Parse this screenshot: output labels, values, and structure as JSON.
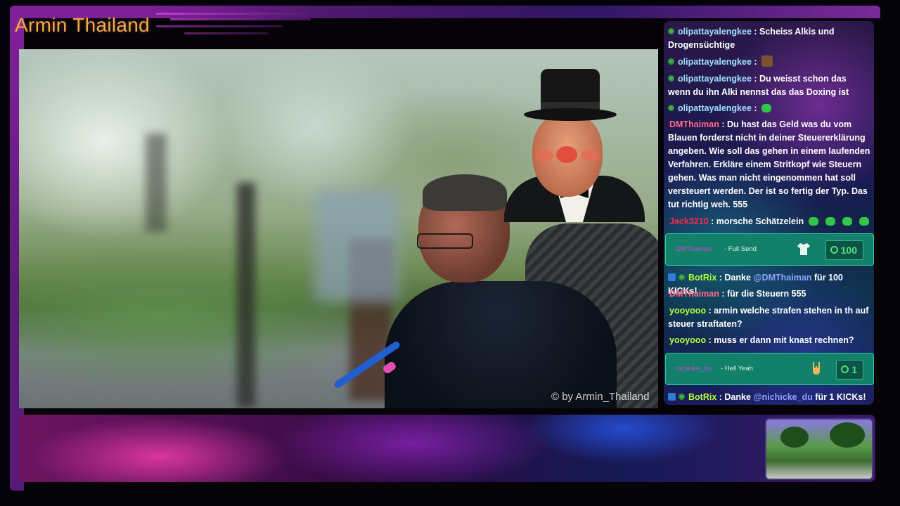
{
  "stream": {
    "title": "Armin Thailand",
    "watermark": "© by Armin_Thailand"
  },
  "colors": {
    "accent_title": "#f3a94e",
    "chat_green_badge": "#3fb54b",
    "alert_bg": "#13806a"
  },
  "chat": {
    "messages": [
      {
        "user": "olipattayalengkee",
        "user_color": "#9fe0ff",
        "sep": " : ",
        "text": "Scheiss Alkis und Drogensüchtige"
      },
      {
        "user": "olipattayalengkee",
        "user_color": "#9fe0ff",
        "sep": " : ",
        "text": "",
        "emote": "brown-face-emote"
      },
      {
        "user": "olipattayalengkee",
        "user_color": "#9fe0ff",
        "sep": " : ",
        "text": "Du weisst schon das wenn du ihn Alki nennst das das Doxing ist"
      },
      {
        "user": "olipattayalengkee",
        "user_color": "#9fe0ff",
        "sep": " : ",
        "text": "",
        "emote": "green-emote"
      },
      {
        "user": "DMThaiman",
        "user_color": "#ff6a8a",
        "sep": " : ",
        "text": "Du hast das Geld was du vom Blauen forderst nicht in deiner Steuererklärung angeben. Wie soll das gehen in einem laufenden Verfahren. Erkläre einem Stritkopf wie Steuern gehen. Was man nicht eingenommen hat soll versteuert werden. Der ist so fertig der Typ. Das tut richtig weh. 555"
      },
      {
        "user": "Jack3210",
        "user_color": "#ff2a4a",
        "sep": " : ",
        "text": "morsche Schätzelein",
        "emote": "green-emote-row"
      },
      {
        "user": "BotRix",
        "user_color": "#b6ff3a",
        "sep": " : ",
        "text_before": "Danke ",
        "mention": "@DMThaiman",
        "text_after": " für 100 KICKs!"
      },
      {
        "user": "DMThaiman",
        "user_color": "#ff6a8a",
        "sep": " : ",
        "text": "für die Steuern 555"
      },
      {
        "user": "yooyooo",
        "user_color": "#b6ff3a",
        "sep": " : ",
        "text": "armin welche strafen stehen in th auf steuer straftaten?"
      },
      {
        "user": "yooyooo",
        "user_color": "#b6ff3a",
        "sep": " : ",
        "text": "muss er dann mit knast rechnen?"
      },
      {
        "user": "BotRix",
        "user_color": "#b6ff3a",
        "sep": " : ",
        "text_before": "Danke ",
        "mention": "@nichicke_du",
        "text_after": " für 1 KICKs!"
      }
    ],
    "alerts": [
      {
        "user": "DMThaiman",
        "message": "- Full Send",
        "icon": "tshirt-icon",
        "amount": "100"
      },
      {
        "user": "nichicke_du",
        "message": "- Hell Yeah",
        "icon": "rock-hand-icon",
        "amount": "1"
      }
    ]
  }
}
